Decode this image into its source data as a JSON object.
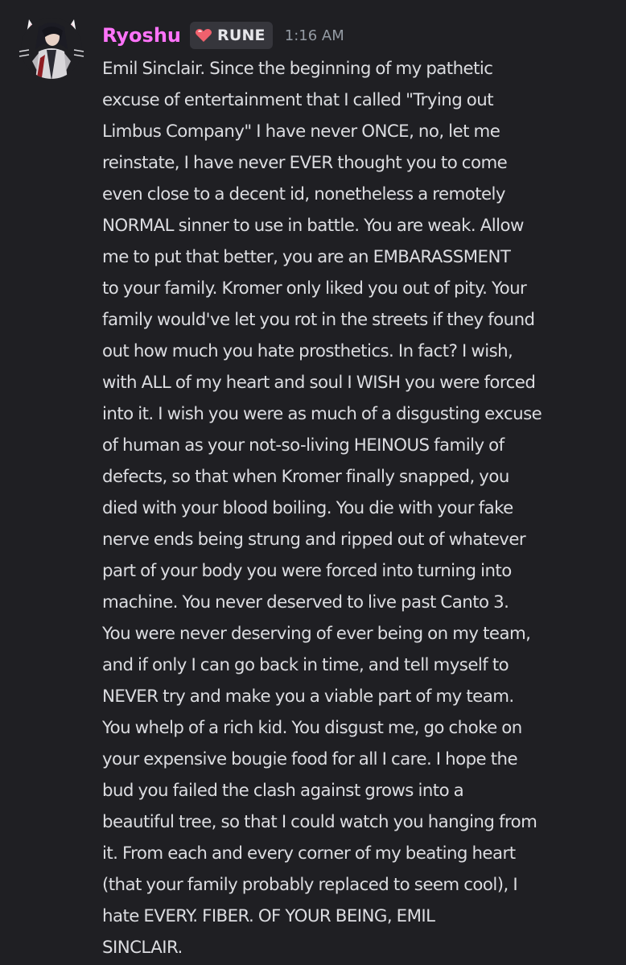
{
  "message": {
    "author": {
      "username": "Ryoshu",
      "username_color": "#ff73fa",
      "avatar_icon": "anime-character-with-cat-ears-avatar",
      "tag": {
        "icon": "heart-icon",
        "label": "RUNE"
      }
    },
    "timestamp": "1:16 AM",
    "content": "Emil Sinclair. Since the beginning of my pathetic\nexcuse of entertainment that I called \"Trying out\nLimbus Company\" I have never ONCE, no, let me\nreinstate, I have never EVER thought you to come\neven close to a decent id, nonetheless a remotely\nNORMAL sinner to use in battle. You are weak. Allow\nme to put that better, you are an EMBARASSMENT\nto your family. Kromer only liked you out of pity. Your\nfamily would've let you rot in the streets if they found\nout how much you hate prosthetics. In fact? I wish,\nwith ALL of my heart and soul I WISH you were forced\ninto it. I wish you were as much of a disgusting excuse\nof human as your not-so-living HEINOUS family of\ndefects, so that when Kromer finally snapped, you\ndied with your blood boiling. You die with your fake\nnerve ends being strung and ripped out of whatever\npart of your body you were forced into turning into\nmachine. You never deserved to live past Canto 3.\nYou were never deserving of ever being on my team,\nand if only I can go back in time, and tell myself to\nNEVER try and make you a viable part of my team.\nYou whelp of a rich kid. You disgust me, go choke on\nyour expensive bougie food for all I care. I hope the\nbud you failed the clash against grows into a\nbeautiful tree, so that I could watch you hanging from\nit. From each and every corner of my beating heart\n(that your family probably replaced to seem cool), I\nhate EVERY. FIBER. OF YOUR BEING, EMIL\nSINCLAIR."
  },
  "colors": {
    "background": "#1f1f23",
    "text": "#dcdde1",
    "timestamp": "#949ba4",
    "tag_background": "#36363c",
    "heart": "#f0616d"
  }
}
